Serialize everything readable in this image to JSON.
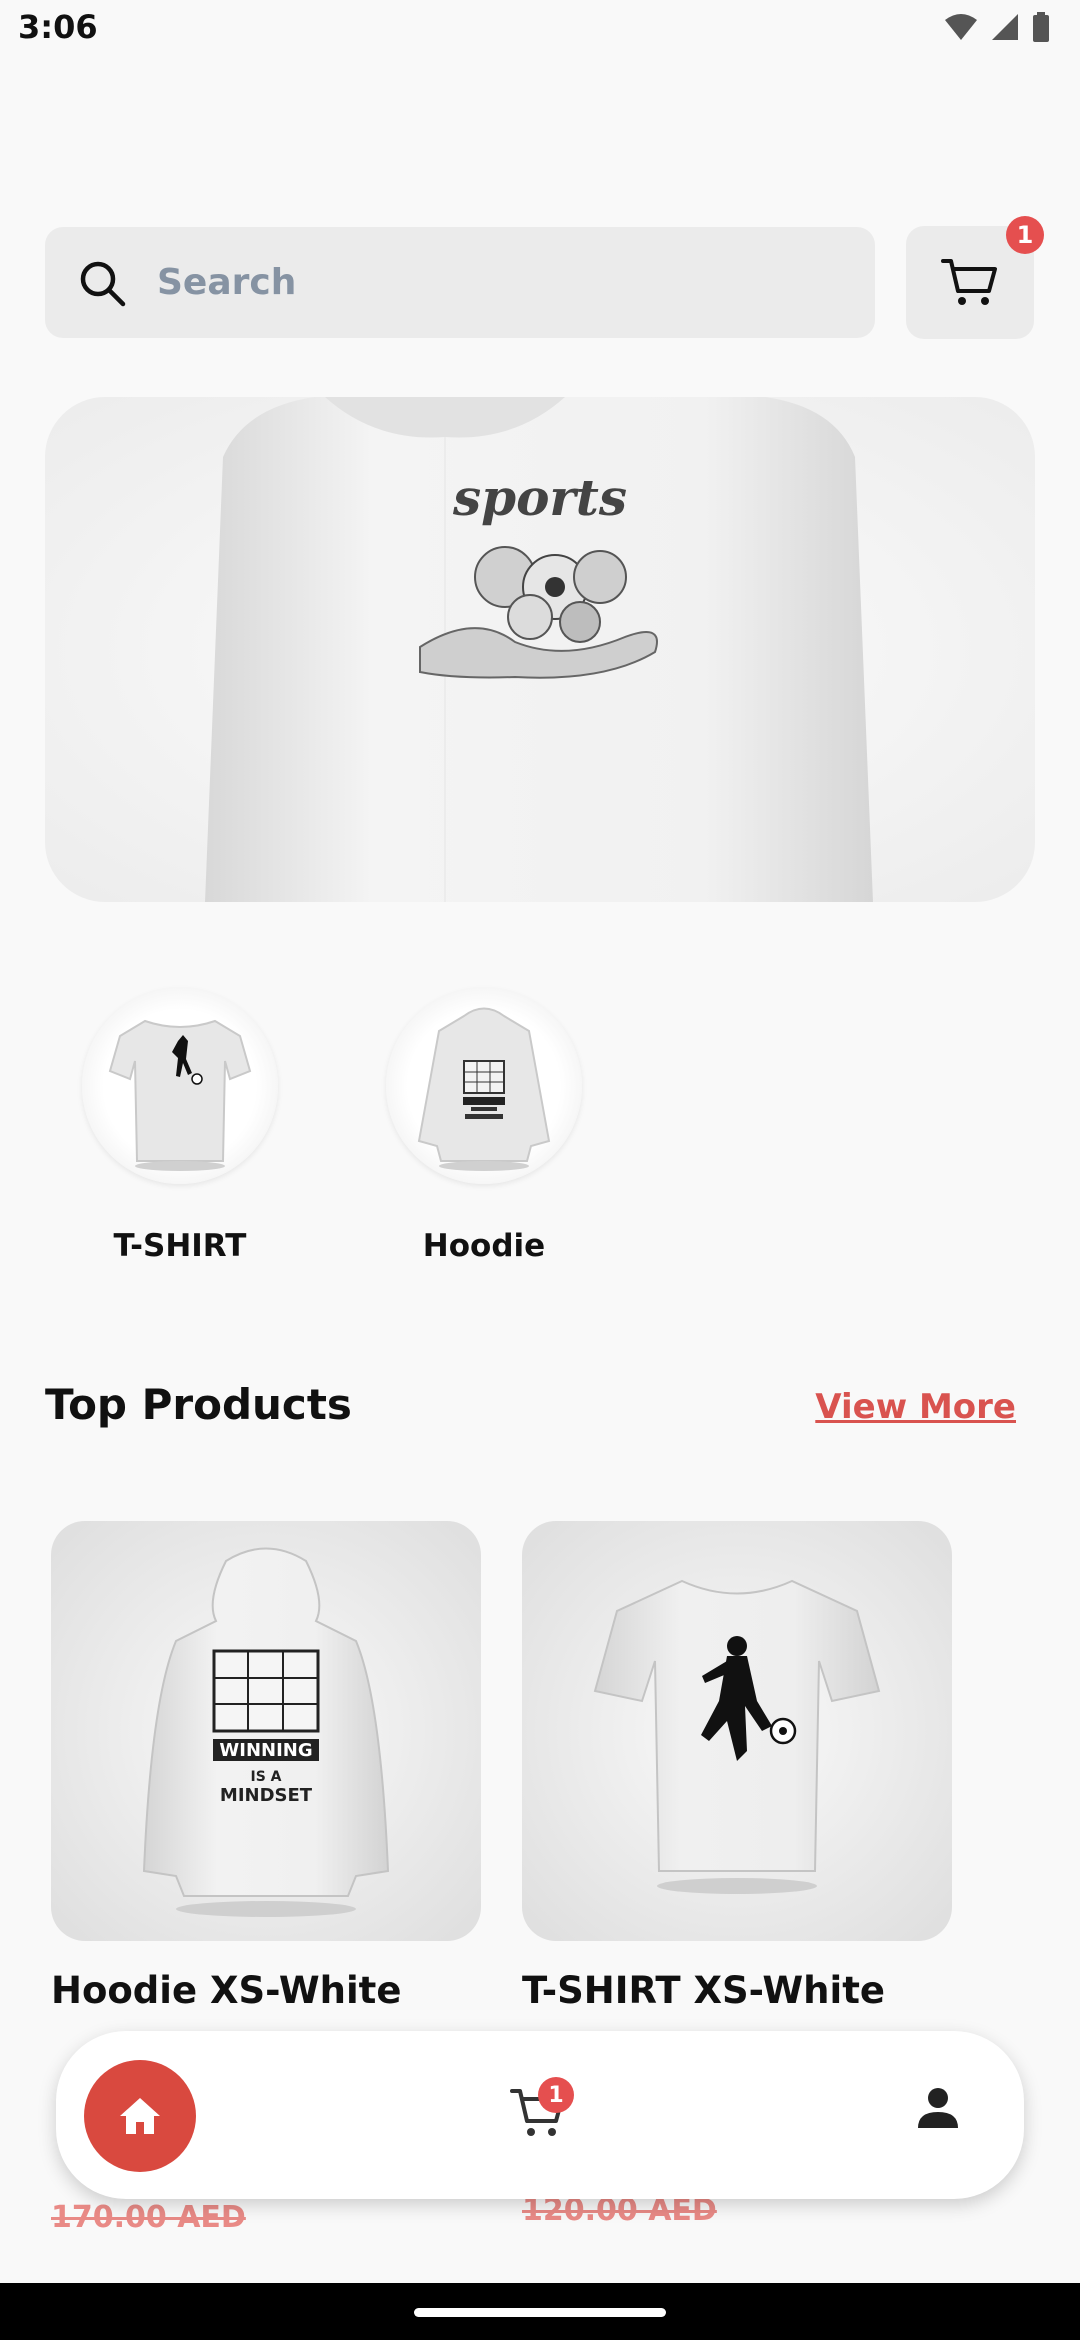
{
  "status_bar": {
    "time": "3:06"
  },
  "search": {
    "placeholder": "Search"
  },
  "cart": {
    "count": "1"
  },
  "banner": {
    "print_text": "sports"
  },
  "categories": [
    {
      "label": "T-SHIRT"
    },
    {
      "label": "Hoodie"
    }
  ],
  "top_products": {
    "title": "Top Products",
    "view_more": "View More",
    "items": [
      {
        "name": "Hoodie XS-White",
        "price": "170.00 AED",
        "print_text_1": "WINNING",
        "print_text_2": "IS A",
        "print_text_3": "MINDSET"
      },
      {
        "name": "T-SHIRT XS-White",
        "price": "120.00 AED"
      }
    ]
  },
  "bottom_nav": {
    "cart_count": "1"
  },
  "colors": {
    "accent": "#d9493f",
    "badge": "#e54f4f",
    "link": "#d9534f",
    "search_text": "#8693a3"
  },
  "icons": [
    "search-icon",
    "cart-icon",
    "home-icon",
    "person-icon",
    "wifi-icon",
    "signal-icon",
    "battery-icon"
  ]
}
